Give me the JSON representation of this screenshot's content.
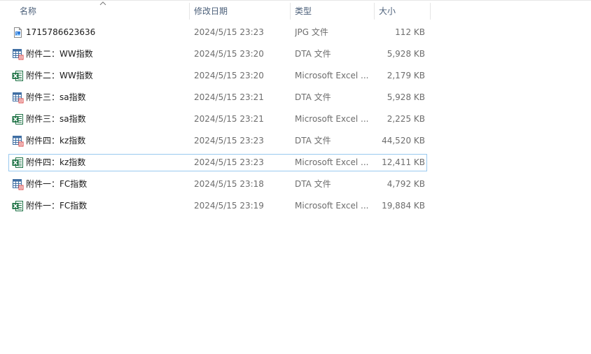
{
  "columns": {
    "name": "名称",
    "date": "修改日期",
    "type": "类型",
    "size": "大小"
  },
  "files": [
    {
      "name": "1715786623636",
      "date": "2024/5/15 23:23",
      "type": "JPG 文件",
      "size": "112 KB",
      "icon": "jpg-file-icon"
    },
    {
      "name": "附件二：WW指数",
      "date": "2024/5/15 23:20",
      "type": "DTA 文件",
      "size": "5,928 KB",
      "icon": "dta-file-icon"
    },
    {
      "name": "附件二：WW指数",
      "date": "2024/5/15 23:20",
      "type": "Microsoft Excel ...",
      "size": "2,179 KB",
      "icon": "excel-file-icon"
    },
    {
      "name": "附件三：sa指数",
      "date": "2024/5/15 23:21",
      "type": "DTA 文件",
      "size": "5,928 KB",
      "icon": "dta-file-icon"
    },
    {
      "name": "附件三：sa指数",
      "date": "2024/5/15 23:21",
      "type": "Microsoft Excel ...",
      "size": "2,225 KB",
      "icon": "excel-file-icon"
    },
    {
      "name": "附件四：kz指数",
      "date": "2024/5/15 23:23",
      "type": "DTA 文件",
      "size": "44,520 KB",
      "icon": "dta-file-icon"
    },
    {
      "name": "附件四：kz指数",
      "date": "2024/5/15 23:23",
      "type": "Microsoft Excel ...",
      "size": "12,411 KB",
      "icon": "excel-file-icon"
    },
    {
      "name": "附件一：FC指数",
      "date": "2024/5/15 23:18",
      "type": "DTA 文件",
      "size": "4,792 KB",
      "icon": "dta-file-icon"
    },
    {
      "name": "附件一：FC指数",
      "date": "2024/5/15 23:19",
      "type": "Microsoft Excel ...",
      "size": "19,884 KB",
      "icon": "excel-file-icon"
    }
  ],
  "focused_index": 6,
  "sort": {
    "column": "name",
    "direction": "ascending"
  },
  "colors": {
    "header_text": "#4c607a",
    "focus_border": "#99c9ef",
    "excel_green": "#1f7346",
    "dta_blue": "#3f6ea3",
    "dta_red": "#d83b3b"
  }
}
